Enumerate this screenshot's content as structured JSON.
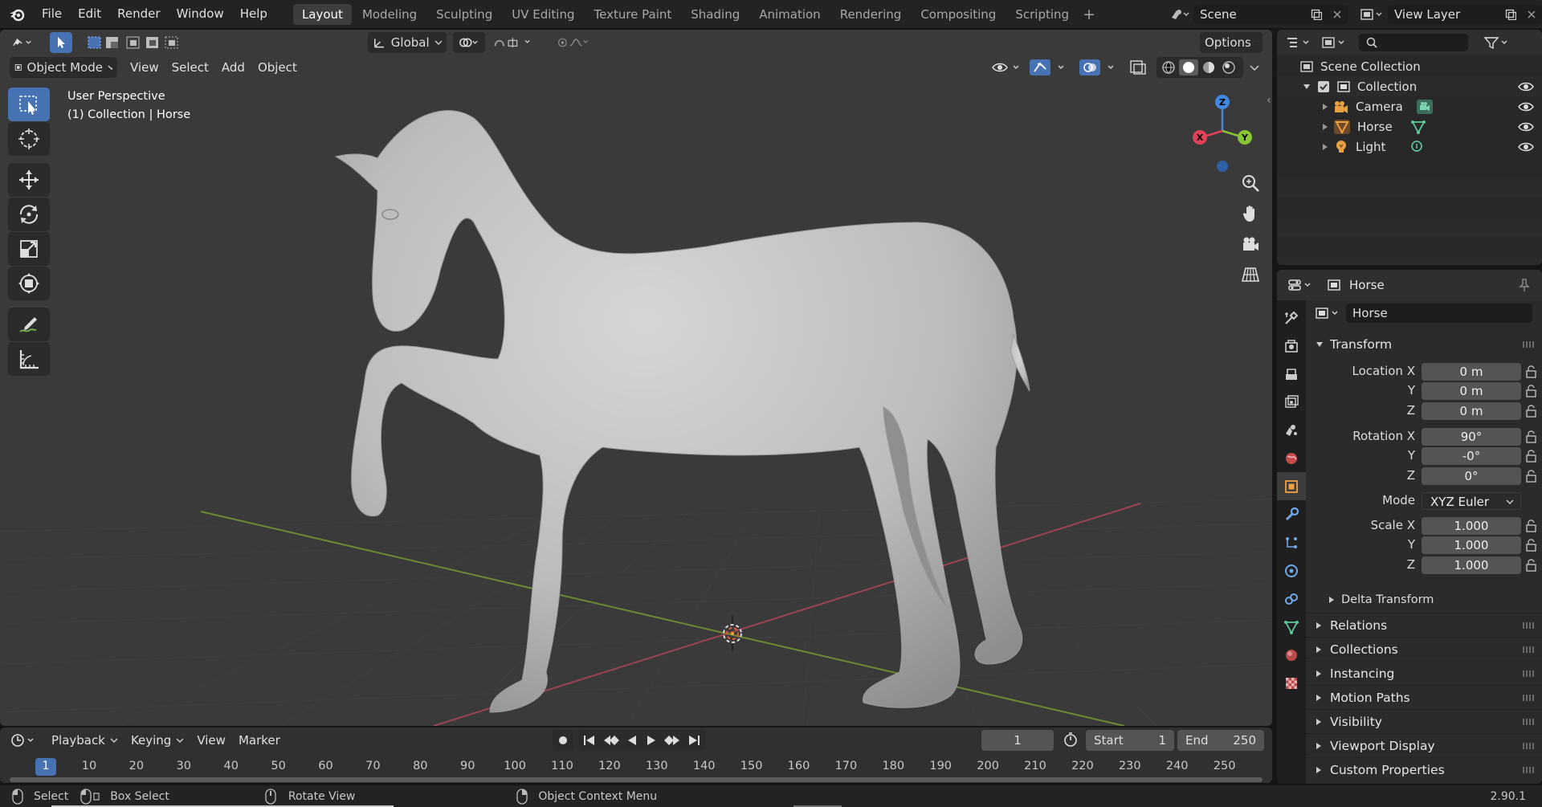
{
  "menu": [
    "File",
    "Edit",
    "Render",
    "Window",
    "Help"
  ],
  "workspaces": [
    "Layout",
    "Modeling",
    "Sculpting",
    "UV Editing",
    "Texture Paint",
    "Shading",
    "Animation",
    "Rendering",
    "Compositing",
    "Scripting"
  ],
  "active_workspace": "Layout",
  "scene": {
    "name": "Scene",
    "view_layer": "View Layer"
  },
  "viewport": {
    "transform_orientation": "Global",
    "options_label": "Options",
    "mode": "Object Mode",
    "header_menus": [
      "View",
      "Select",
      "Add",
      "Object"
    ],
    "perspective_label": "User Perspective",
    "collection_label": "(1) Collection | Horse",
    "gizmo_axes": {
      "x": "X",
      "y": "Y",
      "z": "Z"
    }
  },
  "outliner": {
    "root": "Scene Collection",
    "collection": "Collection",
    "items": [
      "Camera",
      "Horse",
      "Light"
    ]
  },
  "properties": {
    "header_object": "Horse",
    "data_name": "Horse",
    "transform_title": "Transform",
    "location_label": "Location X",
    "location": [
      "0 m",
      "0 m",
      "0 m"
    ],
    "rotation_label": "Rotation X",
    "rotation": [
      "90°",
      "-0°",
      "0°"
    ],
    "mode_label": "Mode",
    "mode_value": "XYZ Euler",
    "scale_label": "Scale X",
    "scale": [
      "1.000",
      "1.000",
      "1.000"
    ],
    "axis_y": "Y",
    "axis_z": "Z",
    "delta_transform": "Delta Transform",
    "panels": [
      "Relations",
      "Collections",
      "Instancing",
      "Motion Paths",
      "Visibility",
      "Viewport Display",
      "Custom Properties"
    ]
  },
  "timeline": {
    "menus": [
      "Playback",
      "Keying",
      "View",
      "Marker"
    ],
    "current_frame": "1",
    "start_label": "Start",
    "start": "1",
    "end_label": "End",
    "end": "250",
    "ruler": [
      "1",
      "10",
      "20",
      "30",
      "40",
      "50",
      "60",
      "70",
      "80",
      "90",
      "100",
      "110",
      "120",
      "130",
      "140",
      "150",
      "160",
      "170",
      "180",
      "190",
      "200",
      "210",
      "220",
      "230",
      "240",
      "250"
    ]
  },
  "status": {
    "select": "Select",
    "box_select": "Box Select",
    "rotate_view": "Rotate View",
    "context_menu": "Object Context Menu",
    "version": "2.90.1"
  },
  "colors": {
    "accent": "#4772b3",
    "x_axis": "#e3405a",
    "y_axis": "#8ac634",
    "z_axis": "#3f88e0",
    "viewport_bg": "#3a3a3a"
  }
}
